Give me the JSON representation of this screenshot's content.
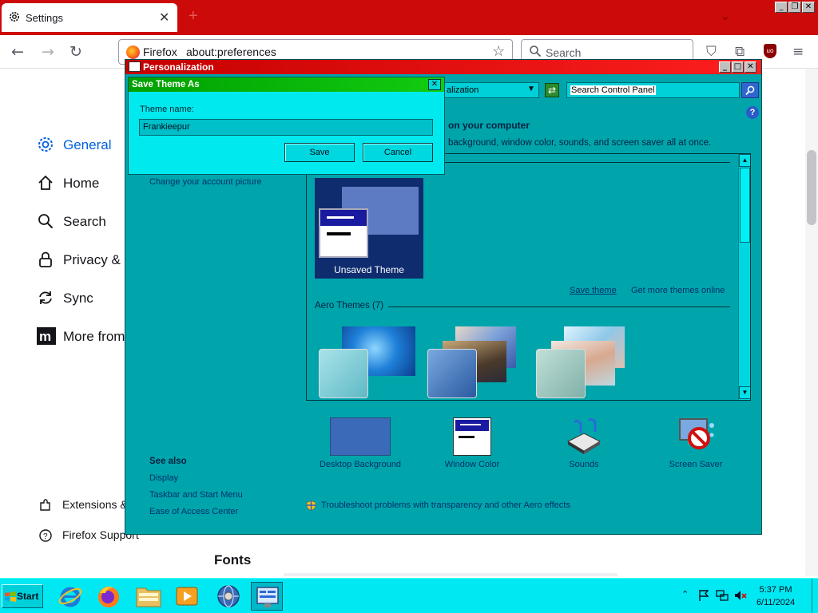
{
  "browser": {
    "tab_title": "Settings",
    "tab_close": "✕",
    "new_tab": "+",
    "list_all_tabs": "⌄",
    "window_controls": {
      "minimize": "_",
      "restore": "❐",
      "close": "✕"
    },
    "identity_label": "Firefox",
    "url": "about:preferences",
    "search_placeholder": "Search"
  },
  "settings_nav": {
    "items": [
      {
        "label": "General",
        "icon": "gear-icon"
      },
      {
        "label": "Home",
        "icon": "home-icon"
      },
      {
        "label": "Search",
        "icon": "search-icon"
      },
      {
        "label": "Privacy & S",
        "icon": "lock-icon"
      },
      {
        "label": "Sync",
        "icon": "sync-icon"
      },
      {
        "label": "More from",
        "icon": "mozilla-icon"
      }
    ],
    "footer": [
      {
        "label": "Extensions &",
        "icon": "puzzle-icon"
      },
      {
        "label": "Firefox Support",
        "icon": "help-icon"
      }
    ]
  },
  "settings_main": {
    "fonts_heading": "Fonts"
  },
  "personalization": {
    "title": "Personalization",
    "address_value": "alization",
    "search_placeholder": "Search Control Panel",
    "help": "?",
    "heading": "on your computer",
    "subtext": "background, window color, sounds, and screen saver all at once.",
    "account_link": "Change your account picture",
    "unsaved_theme": "Unsaved Theme",
    "save_theme_link": "Save theme",
    "more_themes_link": "Get more themes online",
    "aero_label": "Aero Themes (7)",
    "bottom_items": [
      {
        "label": "Desktop Background",
        "icon": "desktop-background-icon"
      },
      {
        "label": "Window Color",
        "icon": "window-color-icon"
      },
      {
        "label": "Sounds",
        "icon": "sounds-icon"
      },
      {
        "label": "Screen Saver",
        "icon": "screen-saver-icon"
      }
    ],
    "see_also_heading": "See also",
    "see_also_links": [
      "Display",
      "Taskbar and Start Menu",
      "Ease of Access Center"
    ],
    "troubleshoot_link": "Troubleshoot problems with transparency and other Aero effects"
  },
  "dialog": {
    "title": "Save Theme As",
    "close": "✕",
    "theme_name_label": "Theme name:",
    "theme_name_value": "Frankieepur",
    "save_label": "Save",
    "cancel_label": "Cancel"
  },
  "taskbar": {
    "start_label": "Start",
    "tray_chevron": "⌃",
    "time": "5:37 PM",
    "date": "6/11/2024"
  },
  "colors": {
    "firefox_titlebar": "#cc0a0a",
    "accent_blue": "#0061e0",
    "cp_window": "#00a5ac",
    "dialog_title": "#11cc11",
    "taskbar": "#00e8f2"
  }
}
